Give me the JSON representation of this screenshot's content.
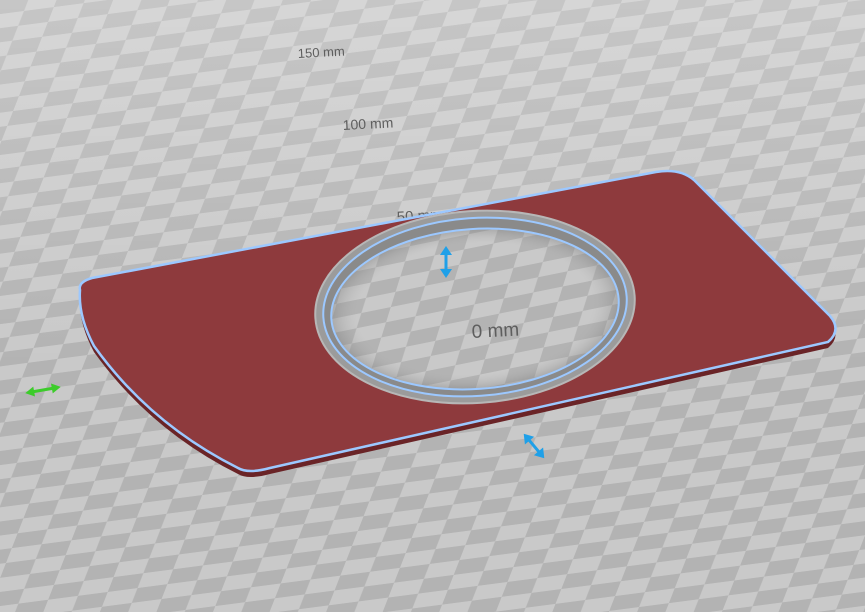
{
  "viewport": {
    "bed_labels": {
      "mm150": "150 mm",
      "mm100": "100 mm",
      "mm50": "50 mm",
      "mm0": "0 mm"
    },
    "icons": {
      "move_x": "double-arrow-horizontal-icon",
      "move_z": "double-arrow-vertical-icon",
      "move_y": "double-arrow-diagonal-icon"
    }
  },
  "colors": {
    "background": "#b9b9b9",
    "grid_light": "#cfcfcf",
    "grid_dark": "#a9a9a9",
    "model_fill": "#8e3a3d",
    "model_outline": "#9cc8ff",
    "gizmo_blue": "#1fa0e8",
    "gizmo_green": "#3ccc2a"
  }
}
